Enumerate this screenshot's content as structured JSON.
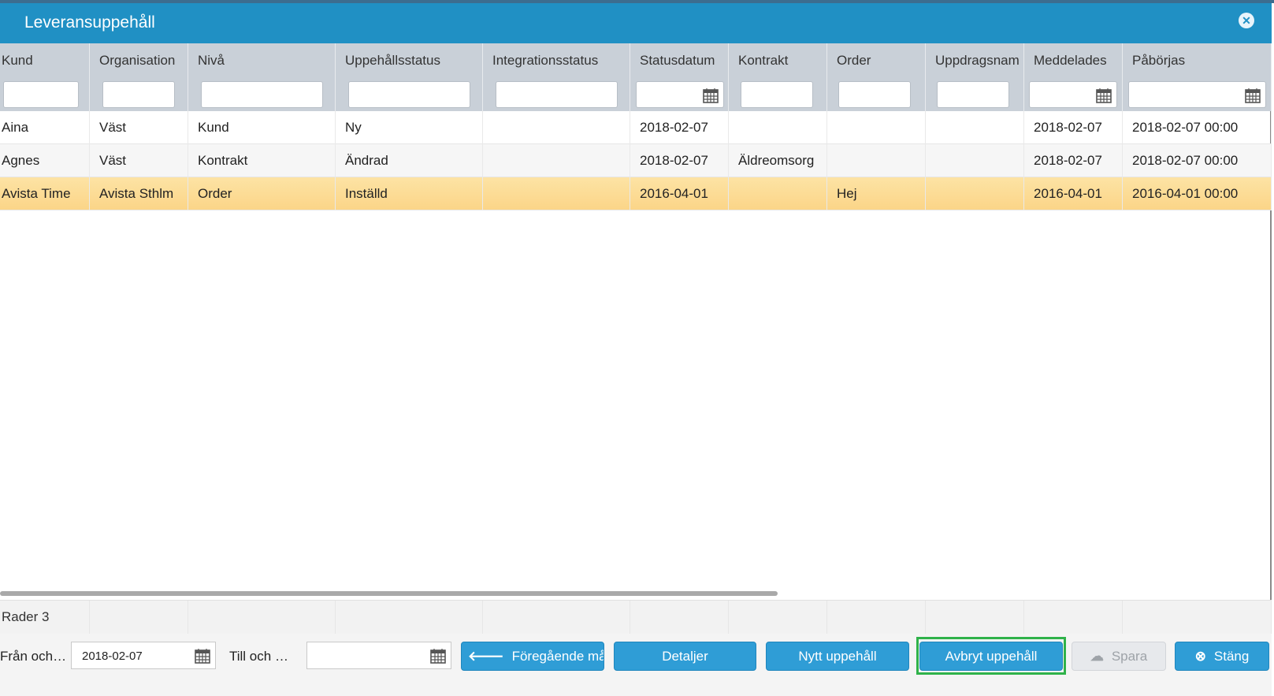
{
  "window": {
    "title": "Leveransuppehåll"
  },
  "columns": [
    "Kund",
    "Organisation",
    "Nivå",
    "Uppehållsstatus",
    "Integrationsstatus",
    "Statusdatum",
    "Kontrakt",
    "Order",
    "Uppdragsnam",
    "Meddelades",
    "Påbörjas"
  ],
  "rows": [
    [
      "Aina",
      "Väst",
      "Kund",
      "Ny",
      "",
      "2018-02-07",
      "",
      "",
      "",
      "2018-02-07",
      "2018-02-07 00:00"
    ],
    [
      "Agnes",
      "Väst",
      "Kontrakt",
      "Ändrad",
      "",
      "2018-02-07",
      "Äldreomsorg",
      "",
      "",
      "2018-02-07",
      "2018-02-07 00:00"
    ],
    [
      "Avista Time",
      "Avista Sthlm",
      "Order",
      "Inställd",
      "",
      "2016-04-01",
      "",
      "Hej",
      "",
      "2016-04-01",
      "2016-04-01 00:00"
    ]
  ],
  "selected_row": 2,
  "footer": {
    "row_count": "Rader 3"
  },
  "bottom": {
    "from_label": "Från och…",
    "from_value": "2018-02-07",
    "to_label": "Till och …",
    "to_value": "",
    "prev_month": "Föregående månad",
    "details": "Detaljer",
    "new_break": "Nytt uppehåll",
    "cancel_break": "Avbryt uppehåll",
    "save": "Spara",
    "close": "Stäng"
  },
  "colors": {
    "titlebar": "#2090c4",
    "button": "#2f9dd6",
    "selected_row": "#fcdb95",
    "highlight": "#2fb24a"
  }
}
